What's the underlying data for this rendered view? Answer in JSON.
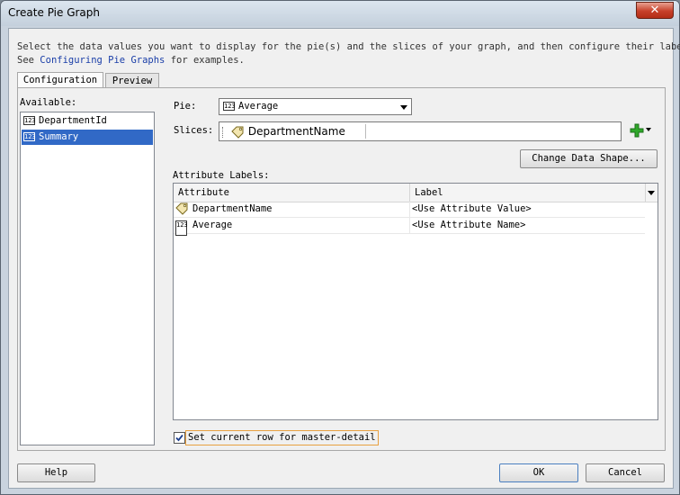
{
  "window": {
    "title": "Create Pie Graph",
    "close_label": "✕"
  },
  "intro": {
    "line1": "Select the data values you want to display for the pie(s) and the slices of your graph, and then configure their labels.",
    "line2_prefix": "See ",
    "line2_link": "Configuring Pie Graphs",
    "line2_suffix": " for examples."
  },
  "tabs": [
    {
      "label": "Configuration",
      "active": true
    },
    {
      "label": "Preview",
      "active": false
    }
  ],
  "available": {
    "label": "Available:",
    "items": [
      {
        "icon": "123",
        "label": "DepartmentId",
        "selected": false
      },
      {
        "icon": "123",
        "label": "Summary",
        "selected": true
      }
    ]
  },
  "pie": {
    "label": "Pie:",
    "icon": "123",
    "value": "Average"
  },
  "slices": {
    "label": "Slices:",
    "value": "DepartmentName"
  },
  "change_shape_label": "Change Data Shape...",
  "attribute_labels": {
    "label": "Attribute Labels:",
    "columns": [
      "Attribute",
      "Label"
    ],
    "rows": [
      {
        "icon": "tag",
        "attribute": "DepartmentName",
        "label": "<Use Attribute Value>"
      },
      {
        "icon": "123",
        "attribute": "Average",
        "label": "<Use Attribute Name>"
      }
    ]
  },
  "master_detail": {
    "label": "Set current row for master-detail",
    "checked": true
  },
  "footer": {
    "help": "Help",
    "ok": "OK",
    "cancel": "Cancel"
  },
  "colors": {
    "selection": "#3169c6",
    "link": "#1a3ea8",
    "close_button": "#c7402a",
    "plus_icon": "#2fa82a"
  }
}
